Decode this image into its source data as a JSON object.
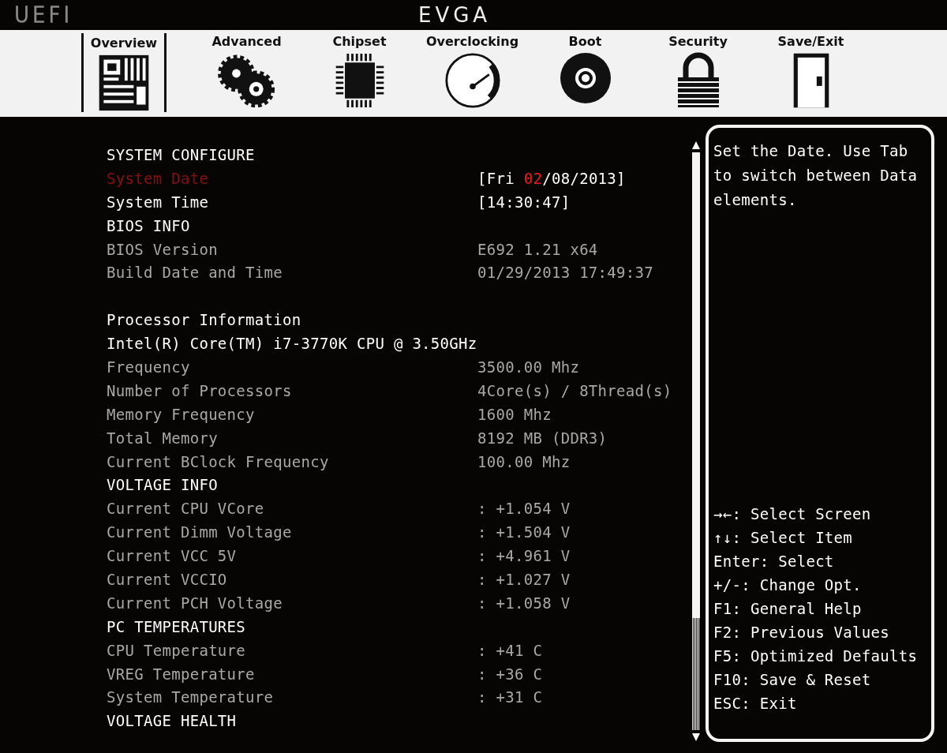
{
  "header": {
    "left_logo": "UEFI",
    "brand": "EVGA"
  },
  "tabs": [
    {
      "label": "Overview",
      "kind": "board",
      "selected": true
    },
    {
      "label": "Advanced",
      "kind": "gears",
      "selected": false
    },
    {
      "label": "Chipset",
      "kind": "chip",
      "selected": false
    },
    {
      "label": "Overclocking",
      "kind": "gauge",
      "selected": false
    },
    {
      "label": "Boot",
      "kind": "disc",
      "selected": false
    },
    {
      "label": "Security",
      "kind": "lock",
      "selected": false
    },
    {
      "label": "Save/Exit",
      "kind": "door",
      "selected": false
    }
  ],
  "rows": [
    {
      "kind": "heading",
      "label": "SYSTEM CONFIGURE"
    },
    {
      "kind": "item",
      "label": "System Date",
      "selected": true,
      "value_parts": [
        {
          "text": "[Fri ",
          "focused": false
        },
        {
          "text": "02",
          "focused": true
        },
        {
          "text": "/08/2013]",
          "focused": false
        }
      ]
    },
    {
      "kind": "item",
      "label": "System Time",
      "selected": false,
      "value_parts": [
        {
          "text": "[14:30:47]",
          "focused": false
        }
      ]
    },
    {
      "kind": "heading",
      "label": "BIOS INFO"
    },
    {
      "kind": "info",
      "label": "BIOS Version",
      "value": "E692 1.21 x64"
    },
    {
      "kind": "info",
      "label": "Build Date and Time",
      "value": "01/29/2013 17:49:37"
    },
    {
      "kind": "blank"
    },
    {
      "kind": "heading",
      "label": "Processor Information"
    },
    {
      "kind": "heading",
      "label": "Intel(R) Core(TM) i7-3770K CPU @ 3.50GHz"
    },
    {
      "kind": "info",
      "label": "Frequency",
      "value": "3500.00 Mhz"
    },
    {
      "kind": "info",
      "label": "Number of Processors",
      "value": "4Core(s) / 8Thread(s)"
    },
    {
      "kind": "info",
      "label": "Memory Frequency",
      "value": "1600 Mhz"
    },
    {
      "kind": "info",
      "label": "Total Memory",
      "value": "8192 MB (DDR3)"
    },
    {
      "kind": "info",
      "label": "Current BClock Frequency",
      "value": "100.00 Mhz"
    },
    {
      "kind": "heading",
      "label": "VOLTAGE INFO"
    },
    {
      "kind": "info",
      "label": "Current CPU VCore",
      "value": ": +1.054 V"
    },
    {
      "kind": "info",
      "label": "Current Dimm Voltage",
      "value": ": +1.504 V"
    },
    {
      "kind": "info",
      "label": "Current VCC 5V",
      "value": ": +4.961 V"
    },
    {
      "kind": "info",
      "label": "Current VCCIO",
      "value": ": +1.027 V"
    },
    {
      "kind": "info",
      "label": "Current PCH Voltage",
      "value": ": +1.058 V"
    },
    {
      "kind": "heading",
      "label": "PC TEMPERATURES"
    },
    {
      "kind": "info",
      "label": "CPU Temperature",
      "value": ": +41 C"
    },
    {
      "kind": "info",
      "label": "VREG Temperature",
      "value": ": +36 C"
    },
    {
      "kind": "info",
      "label": "System Temperature",
      "value": ": +31 C"
    },
    {
      "kind": "heading",
      "label": "VOLTAGE HEALTH"
    }
  ],
  "help": {
    "description": "Set the Date. Use Tab to switch between Data elements.",
    "keys": [
      "→←: Select Screen",
      "↑↓: Select Item",
      "Enter: Select",
      "+/-: Change Opt.",
      "F1: General Help",
      "F2: Previous Values",
      "F5: Optimized Defaults",
      "F10: Save & Reset",
      "ESC: Exit"
    ]
  }
}
